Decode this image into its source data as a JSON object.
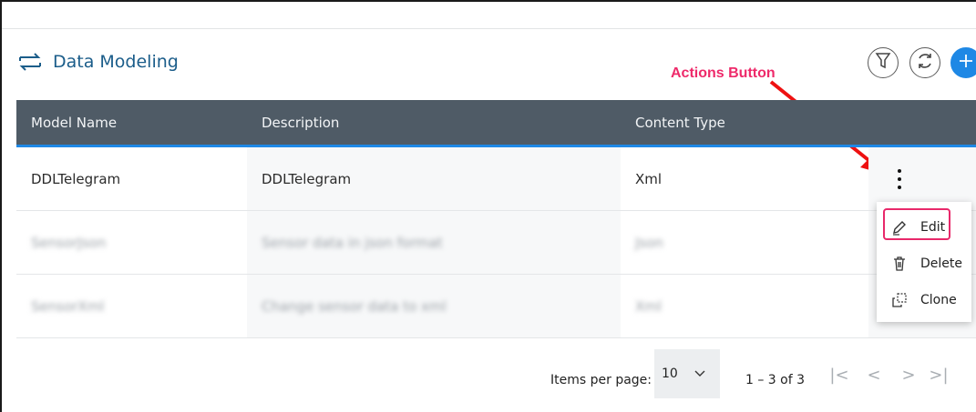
{
  "header": {
    "title": "Data Modeling"
  },
  "annotation": {
    "text": "Actions Button"
  },
  "table": {
    "columns": [
      "Model Name",
      "Description",
      "Content Type"
    ],
    "rows": [
      {
        "name": "DDLTelegram",
        "description": "DDLTelegram",
        "content_type": "Xml"
      },
      {
        "name": "SensorJson",
        "description": "Sensor data in json format",
        "content_type": "Json"
      },
      {
        "name": "SensorXml",
        "description": "Change sensor data to xml",
        "content_type": "Xml"
      }
    ]
  },
  "actions_menu": {
    "items": [
      {
        "label": "Edit",
        "icon": "pencil-icon"
      },
      {
        "label": "Delete",
        "icon": "trash-icon"
      },
      {
        "label": "Clone",
        "icon": "clone-icon"
      }
    ]
  },
  "pagination": {
    "items_per_page_label": "Items per page:",
    "items_per_page_value": "10",
    "range": "1 – 3 of 3"
  },
  "colors": {
    "header_bg": "#4f5b66",
    "accent": "#1e88e5",
    "title": "#1b5d8a",
    "annotation": "#ee2a6a"
  }
}
